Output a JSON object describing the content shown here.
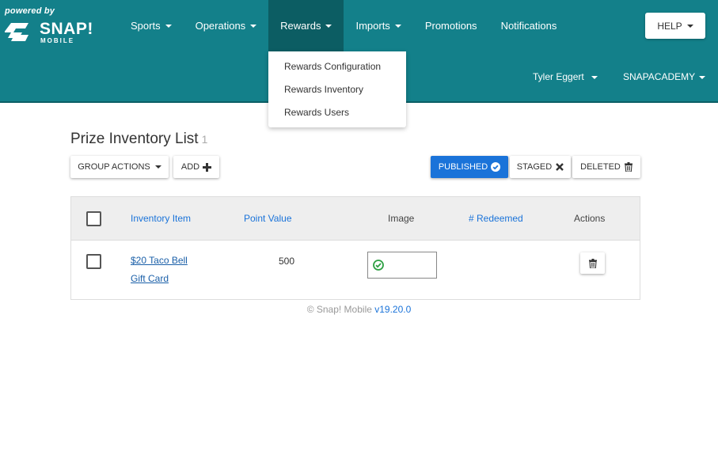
{
  "brand": {
    "powered_by": "powered by",
    "name": "SNAP!",
    "sub": "MOBILE"
  },
  "nav": {
    "items": [
      {
        "label": "Sports",
        "has_caret": true
      },
      {
        "label": "Operations",
        "has_caret": true
      },
      {
        "label": "Rewards",
        "has_caret": true,
        "active": true
      },
      {
        "label": "Imports",
        "has_caret": true
      },
      {
        "label": "Promotions",
        "has_caret": false
      },
      {
        "label": "Notifications",
        "has_caret": false
      }
    ],
    "help_label": "HELP",
    "user_label": "Tyler Eggert",
    "org_label": "SNAPACADEMY"
  },
  "rewards_menu": {
    "items": [
      "Rewards Configuration",
      "Rewards Inventory",
      "Rewards Users"
    ]
  },
  "page": {
    "title": "Prize Inventory List",
    "count": "1"
  },
  "toolbar": {
    "group_actions_label": "GROUP ACTIONS",
    "add_label": "ADD",
    "published_label": "PUBLISHED",
    "staged_label": "STAGED",
    "deleted_label": "DELETED"
  },
  "table": {
    "headers": {
      "item": "Inventory Item",
      "points": "Point Value",
      "image": "Image",
      "redeemed": "# Redeemed",
      "actions": "Actions"
    },
    "rows": [
      {
        "item_line1": "$20 Taco Bell",
        "item_line2": "Gift Card",
        "points": "500",
        "image_status_icon": "check-circle-icon",
        "redeemed": ""
      }
    ]
  },
  "footer": {
    "copyright": "© Snap! Mobile",
    "version": "v19.20.0"
  },
  "colors": {
    "header_bg": "#13808a",
    "active_nav_bg": "#0c5d63",
    "primary_button": "#1a73d9",
    "link": "#1a73d9",
    "success_icon": "#2ea043"
  }
}
